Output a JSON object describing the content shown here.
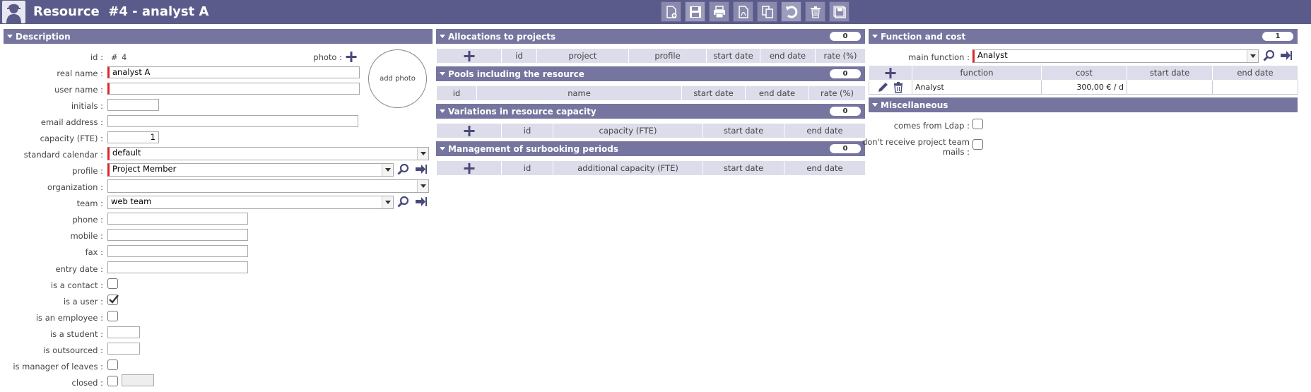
{
  "header": {
    "entity": "Resource",
    "id_label": "#4",
    "name": "analyst A"
  },
  "toolbar": [
    "new-icon",
    "save-icon",
    "print-icon",
    "pdf-icon",
    "copy-icon",
    "undo-icon",
    "delete-icon",
    "multi-save-icon"
  ],
  "description": {
    "title": "Description",
    "fields": {
      "id": {
        "label": "id :",
        "hash": "#",
        "value": "4"
      },
      "photo": {
        "label": "photo :",
        "placeholder": "add photo"
      },
      "real_name": {
        "label": "real name :",
        "value": "analyst A"
      },
      "user_name": {
        "label": "user name :",
        "value": ""
      },
      "initials": {
        "label": "initials :",
        "value": ""
      },
      "email": {
        "label": "email address :",
        "value": ""
      },
      "capacity": {
        "label": "capacity (FTE) :",
        "value": "1"
      },
      "calendar": {
        "label": "standard calendar :",
        "value": "default"
      },
      "profile": {
        "label": "profile :",
        "value": "Project Member"
      },
      "organization": {
        "label": "organization :",
        "value": ""
      },
      "team": {
        "label": "team :",
        "value": "web team"
      },
      "phone": {
        "label": "phone :",
        "value": ""
      },
      "mobile": {
        "label": "mobile :",
        "value": ""
      },
      "fax": {
        "label": "fax :",
        "value": ""
      },
      "entry_date": {
        "label": "entry date :",
        "value": ""
      },
      "is_contact": {
        "label": "is a contact :",
        "checked": false
      },
      "is_user": {
        "label": "is a user :",
        "checked": true
      },
      "is_employee": {
        "label": "is an employee :",
        "checked": false
      },
      "is_student": {
        "label": "is a student :",
        "value": ""
      },
      "is_outsourced": {
        "label": "is outsourced :",
        "value": ""
      },
      "is_manager_leaves": {
        "label": "is manager of leaves :",
        "checked": false
      },
      "closed": {
        "label": "closed :",
        "checked": false,
        "value": ""
      }
    }
  },
  "allocations": {
    "title": "Allocations to projects",
    "count": "0",
    "columns": [
      "id",
      "project",
      "profile",
      "start date",
      "end date",
      "rate (%)"
    ]
  },
  "pools": {
    "title": "Pools including the resource",
    "count": "0",
    "columns": [
      "id",
      "name",
      "start date",
      "end date",
      "rate (%)"
    ]
  },
  "variations": {
    "title": "Variations in resource capacity",
    "count": "0",
    "columns": [
      "id",
      "capacity (FTE)",
      "start date",
      "end date"
    ]
  },
  "surbooking": {
    "title": "Management of surbooking periods",
    "count": "0",
    "columns": [
      "id",
      "additional capacity (FTE)",
      "start date",
      "end date"
    ]
  },
  "function_cost": {
    "title": "Function and cost",
    "count": "1",
    "main_function_label": "main function :",
    "main_function_value": "Analyst",
    "columns": [
      "function",
      "cost",
      "start date",
      "end date"
    ],
    "rows": [
      {
        "function": "Analyst",
        "cost": "300,00 € / d",
        "start": "",
        "end": ""
      }
    ]
  },
  "misc": {
    "title": "Miscellaneous",
    "ldap_label": "comes from Ldap :",
    "mails_label_1": "don't receive project team",
    "mails_label_2": "mails :"
  },
  "colors": {
    "header": "#5b5b8b",
    "section": "#75759f",
    "required": "#d9252b"
  }
}
